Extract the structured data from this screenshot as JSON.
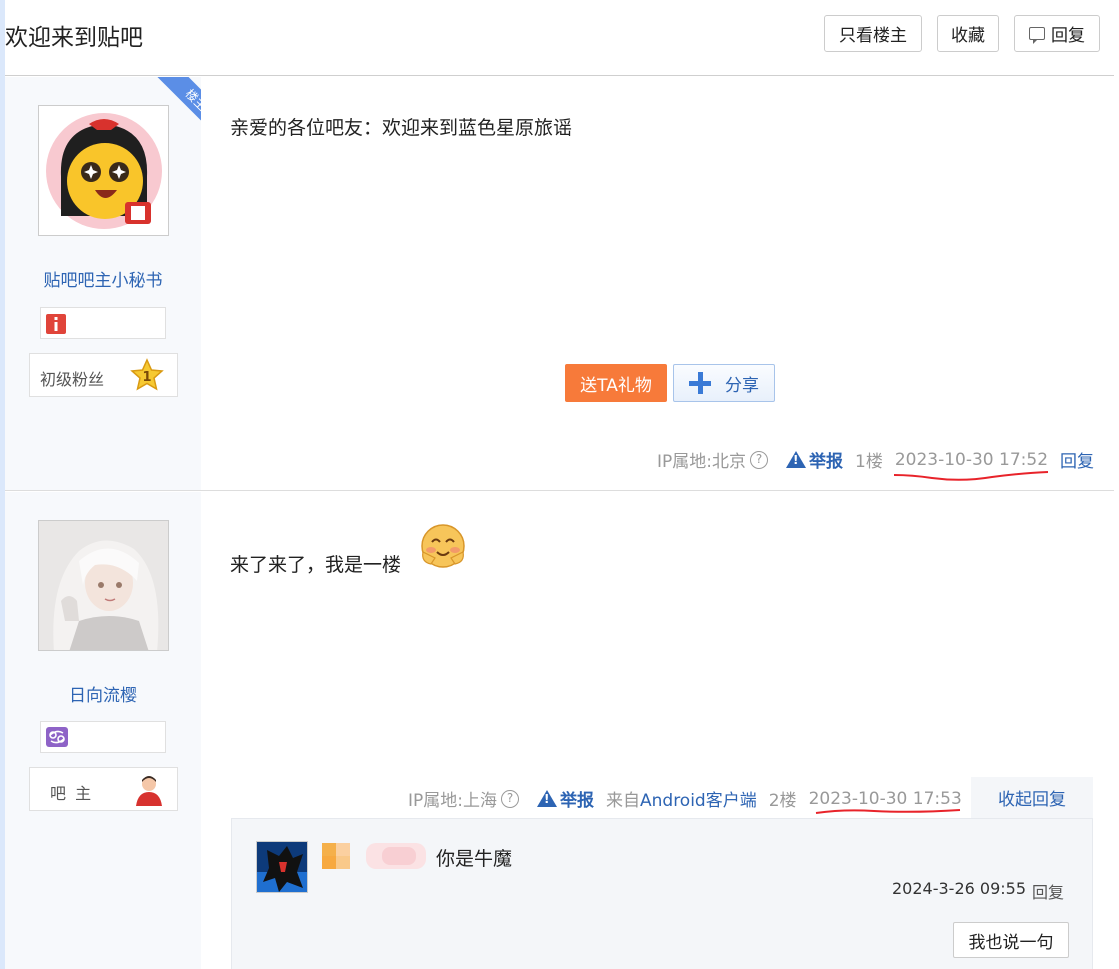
{
  "header": {
    "title": "欢迎来到贴吧",
    "only_op_label": "只看楼主",
    "favorite_label": "收藏",
    "reply_label": "回复"
  },
  "posts": [
    {
      "badge_label": "楼主",
      "username": "贴吧吧主小秘书",
      "level_label": "初级粉丝",
      "level_number": "1",
      "content": "亲爱的各位吧友：欢迎来到蓝色星原旅谣",
      "gift_label": "送TA礼物",
      "share_label": "分享",
      "ip": "IP属地:北京",
      "report_label": "举报",
      "floor": "1楼",
      "time": "2023-10-30 17:52",
      "reply_label": "回复"
    },
    {
      "username": "日向流樱",
      "role_label": "吧 主",
      "content": "来了来了，我是一楼",
      "ip": "IP属地:上海",
      "report_label": "举报",
      "source_prefix": "来自",
      "source_link": "Android客户端",
      "floor": "2楼",
      "time": "2023-10-30 17:53",
      "collapse_label": "收起回复",
      "sub_replies": [
        {
          "text": "你是牛魔",
          "time": "2024-3-26 09:55",
          "reply_label": "回复"
        }
      ],
      "say_button_label": "我也说一句"
    }
  ],
  "colors": {
    "link_blue": "#2d64b3",
    "gift_orange": "#f77a3a",
    "sidebar_bg": "#f7f9fc",
    "annotation_red": "#e8232a"
  },
  "icons": [
    "reply-icon",
    "question-icon",
    "warning-icon",
    "plus-icon",
    "info-icon",
    "constellation-icon",
    "star-level-icon",
    "moderator-icon"
  ]
}
